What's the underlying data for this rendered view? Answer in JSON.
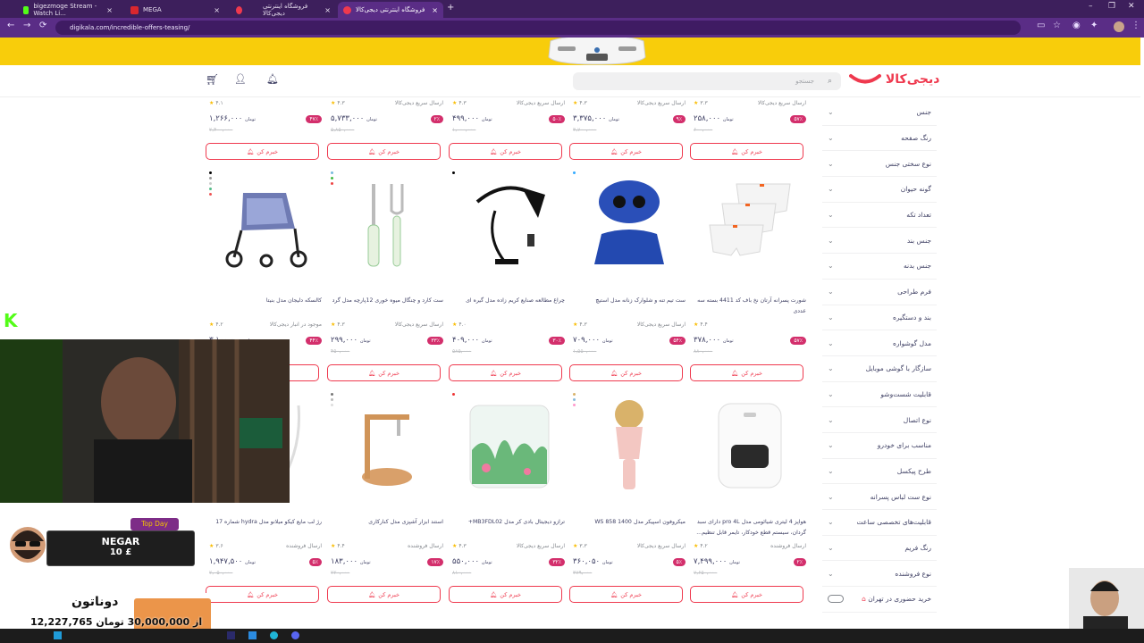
{
  "browser": {
    "tabs": [
      {
        "label": "bigezmoge Stream - Watch Li...",
        "fav_color": "#53fc18",
        "active": false
      },
      {
        "label": "MEGA",
        "fav_color": "#d9272e",
        "active": false
      },
      {
        "label": "",
        "fav_color": "#ef394e",
        "active": false
      },
      {
        "label": "فروشگاه اینترنتی دیجی‌کالا",
        "fav_color": "#ef394e",
        "active": false
      },
      {
        "label": "فروشگاه اینترنتی دیجی‌کالا",
        "fav_color": "#ef394e",
        "active": true
      }
    ],
    "url": "digikala.com/incredible-offers-teasing/"
  },
  "header": {
    "logo": "دیجی‌کالا",
    "search_placeholder": "جستجو"
  },
  "sidebar": {
    "filters": [
      "جنس",
      "رنگ صفحه",
      "نوع سختی جنس",
      "گونه حیوان",
      "تعداد تکه",
      "جنس بند",
      "جنس بدنه",
      "فرم طراحی",
      "بند و دستگیره",
      "مدل گوشواره",
      "سازگار با گوشی موبایل",
      "قابلیت شست‌وشو",
      "نوع اتصال",
      "مناسب برای خودرو",
      "طرح پیکسل",
      "نوع ست لباس پسرانه",
      "قابلیت‌های تخصصی ساعت",
      "رنگ فریم",
      "نوع فروشنده"
    ],
    "tehran_toggle": "خرید حضوری در تهران"
  },
  "labels": {
    "notify": "خبرم کن",
    "toman": "تومان"
  },
  "row0": [
    {
      "rating": "۴.۱",
      "seller": "",
      "price": "۱,۲۶۶,۰۰۰",
      "discount": "۴۷٪",
      "old": "۲,۴۰۰,۰۰۰"
    },
    {
      "rating": "۴.۳",
      "seller": "ارسال سریع دیجی‌کالا",
      "price": "۵,۷۳۳,۰۰۰",
      "discount": "۲٪",
      "old": "۵,۸۵۰,۰۰۰"
    },
    {
      "rating": "۴.۳",
      "seller": "ارسال سریع دیجی‌کالا",
      "price": "۴۹۹,۰۰۰",
      "discount": "۵۰٪",
      "old": "۱,۰۰۰,۰۰۰"
    },
    {
      "rating": "۴.۳",
      "seller": "ارسال سریع دیجی‌کالا",
      "price": "۳,۳۷۵,۰۰۰",
      "discount": "۹٪",
      "old": "۳,۷۰۰,۰۰۰"
    },
    {
      "rating": "۳.۳",
      "seller": "ارسال سریع دیجی‌کالا",
      "price": "۲۵۸,۰۰۰",
      "discount": "۵۷٪",
      "old": "۶۰۰,۰۰۰"
    }
  ],
  "row1": [
    {
      "title": "کالسکه دلیجان مدل بنیتا",
      "rating": "۴.۲",
      "seller": "موجود در انبار دیجی‌کالا",
      "price": "۳,۱۰۰,۰۰۰",
      "discount": "۴۴٪",
      "old": "۵,۵۰۰,۰۰۰"
    },
    {
      "title": "ست کارد و چنگال میوه خوری 12پارچه مدل گرد",
      "rating": "۴.۳",
      "seller": "ارسال سریع دیجی‌کالا",
      "price": "۲۹۹,۰۰۰",
      "discount": "۳۳٪",
      "old": "۴۵۰,۰۰۰"
    },
    {
      "title": "چراغ مطالعه صنایع کریم زاده مدل گیره ای",
      "rating": "۴.۰",
      "seller": "",
      "price": "۴۰۹,۰۰۰",
      "discount": "۳۰٪",
      "old": "۵۸۵,۰۰۰"
    },
    {
      "title": "ست تیم تنه و شلوارک زنانه مدل استیچ",
      "rating": "۴.۳",
      "seller": "ارسال سریع دیجی‌کالا",
      "price": "۷۰۹,۰۰۰",
      "discount": "۵۴٪",
      "old": "۱,۵۵۰,۰۰۰"
    },
    {
      "title": "شورت پسرانه آرتان نخ باف کد 4411 بسته سه عددی",
      "rating": "۴.۴",
      "seller": "",
      "price": "۳۷۸,۰۰۰",
      "discount": "۵۷٪",
      "old": "۸۸۰,۰۰۰"
    }
  ],
  "row2": [
    {
      "title": "رژ لب مایع کیکو میلانو مدل hydra شماره 17",
      "rating": "۳.۶",
      "seller": "ارسال فروشنده",
      "price": "۱,۹۴۷,۵۰۰",
      "discount": "۵٪",
      "old": "۲,۰۵۰,۰۰۰"
    },
    {
      "title": "استند ابزار آشپزی مدل کنارکاری",
      "rating": "۴.۴",
      "seller": "ارسال فروشنده",
      "price": "۱۸۳,۰۰۰",
      "discount": "۱۷٪",
      "old": "۲۲۰,۰۰۰"
    },
    {
      "title": "ترازو دیجیتال بادی کر مدل MB3FDL02+",
      "rating": "۴.۳",
      "seller": "ارسال سریع دیجی‌کالا",
      "price": "۵۵۰,۰۰۰",
      "discount": "۳۲٪",
      "old": "۸۱۰,۰۰۰"
    },
    {
      "title": "میکروفون اسپیکر مدل WS 858 1400",
      "rating": "۳.۳",
      "seller": "ارسال سریع دیجی‌کالا",
      "price": "۳۶۰,۰۵۰",
      "discount": "۵٪",
      "old": "۳۷۹,۰۰۰"
    },
    {
      "title": "هواپز 4 لیتری شیائومی مدل pro 4L دارای سبد گردان، سیستم قطع خودکار، تایمر قابل تنظیم...",
      "rating": "۴.۲",
      "seller": "ارسال فروشنده",
      "price": "۷,۴۹۹,۰۰۰",
      "discount": "۲٪",
      "old": "۷,۶۵۰,۰۰۰"
    }
  ],
  "stream": {
    "kick_logo": "K",
    "top_day_label": "Top Day",
    "donor_name": "NEGAR",
    "donor_amount": "10 £",
    "goal_title": "دوناتون",
    "goal_text": "12,227,765 از 30,000,000 تومان"
  }
}
